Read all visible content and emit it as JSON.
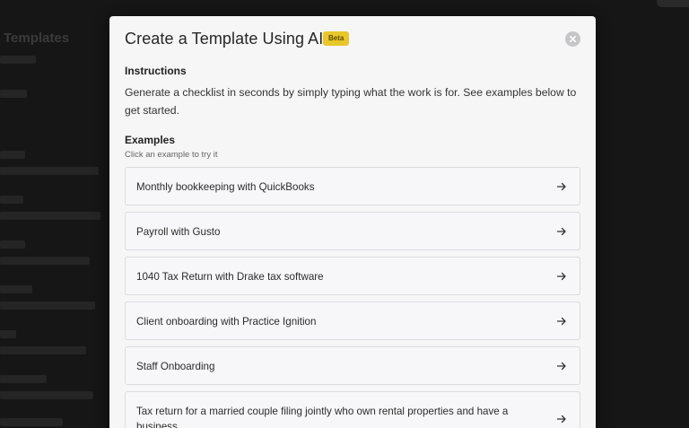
{
  "background": {
    "title": "Templates"
  },
  "modal": {
    "title": "Create a Template Using AI",
    "badge": "Beta",
    "instructions": {
      "heading": "Instructions",
      "text": "Generate a checklist in seconds by simply typing what the work is for. See examples below to get started."
    },
    "examples": {
      "heading": "Examples",
      "subtitle": "Click an example to try it",
      "items": [
        {
          "label": "Monthly bookkeeping with QuickBooks"
        },
        {
          "label": "Payroll with Gusto"
        },
        {
          "label": "1040 Tax Return with Drake tax software"
        },
        {
          "label": "Client onboarding with Practice Ignition"
        },
        {
          "label": "Staff Onboarding"
        },
        {
          "label": "Tax return for a married couple filing jointly who own rental properties and have a business"
        }
      ]
    }
  },
  "icons": {
    "close": "close-icon",
    "arrow": "arrow-right-icon"
  },
  "colors": {
    "badge": "#e9c72a",
    "modal_bg": "#f6f6f7",
    "overlay": "#161616"
  }
}
